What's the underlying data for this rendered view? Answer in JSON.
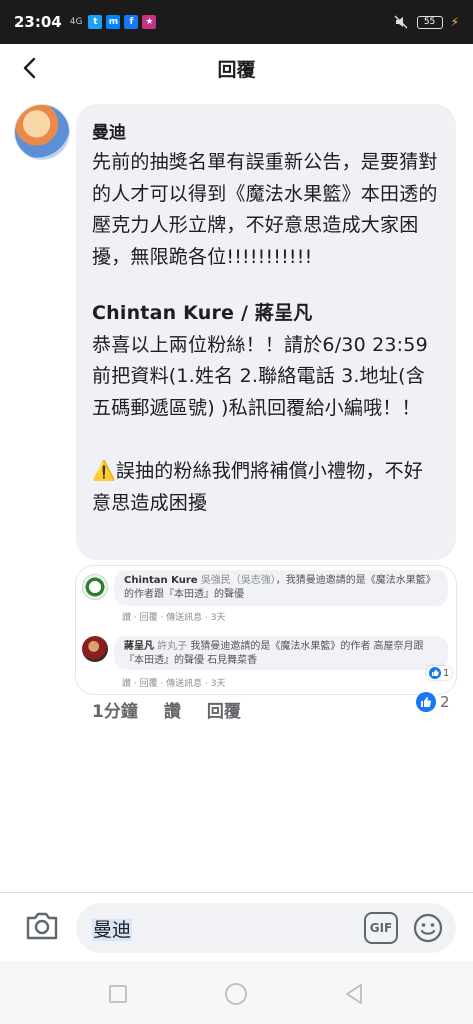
{
  "status_bar": {
    "time": "23:04",
    "signal": "4G",
    "battery": "55",
    "apps": [
      {
        "name": "twitter-icon",
        "color": "#1da1f2",
        "glyph": "t"
      },
      {
        "name": "messenger-icon",
        "color": "#0084ff",
        "glyph": "m"
      },
      {
        "name": "facebook-icon",
        "color": "#1877f2",
        "glyph": "f"
      },
      {
        "name": "app-icon",
        "color": "#c13584",
        "glyph": "★"
      }
    ]
  },
  "header": {
    "title": "回覆"
  },
  "comment": {
    "author": "曼迪",
    "paragraph1": "先前的抽獎名單有誤重新公告，是要猜對的人才可以得到《魔法水果籃》本田透的壓克力人形立牌，不好意思造成大家困擾，無限跪各位!!!!!!!!!!!",
    "winners": "Chintan Kure / 蔣呈凡",
    "paragraph2": "恭喜以上兩位粉絲！！請於6/30 23:59前把資料(1.姓名 2.聯絡電話 3.地址(含五碼郵遞區號) )私訊回覆給小編哦！！",
    "warning_icon": "⚠️",
    "paragraph3": "誤抽的粉絲我們將補償小禮物，不好意思造成困擾"
  },
  "replies": [
    {
      "author": "Chintan Kure",
      "tag": "吳強民（吳志強）",
      "text": "，我猜曼迪邀請的是《魔法水果籃》的作者跟『本田透』的聲優",
      "meta": "讚 · 回覆 · 傳送訊息 · 3天"
    },
    {
      "author": "蔣呈凡",
      "tag": "許丸子",
      "text": "我猜曼迪邀請的是《魔法水果籃》的作者 高屋奈月跟『本田透』的聲優 石見舞菜香",
      "meta": "讚 · 回覆 · 傳送訊息 · 3天",
      "likes": "1"
    }
  ],
  "actions": {
    "time": "1分鐘",
    "like": "讚",
    "reply": "回覆",
    "like_count": "2"
  },
  "composer": {
    "mention": "曼迪",
    "gif_label": "GIF"
  }
}
